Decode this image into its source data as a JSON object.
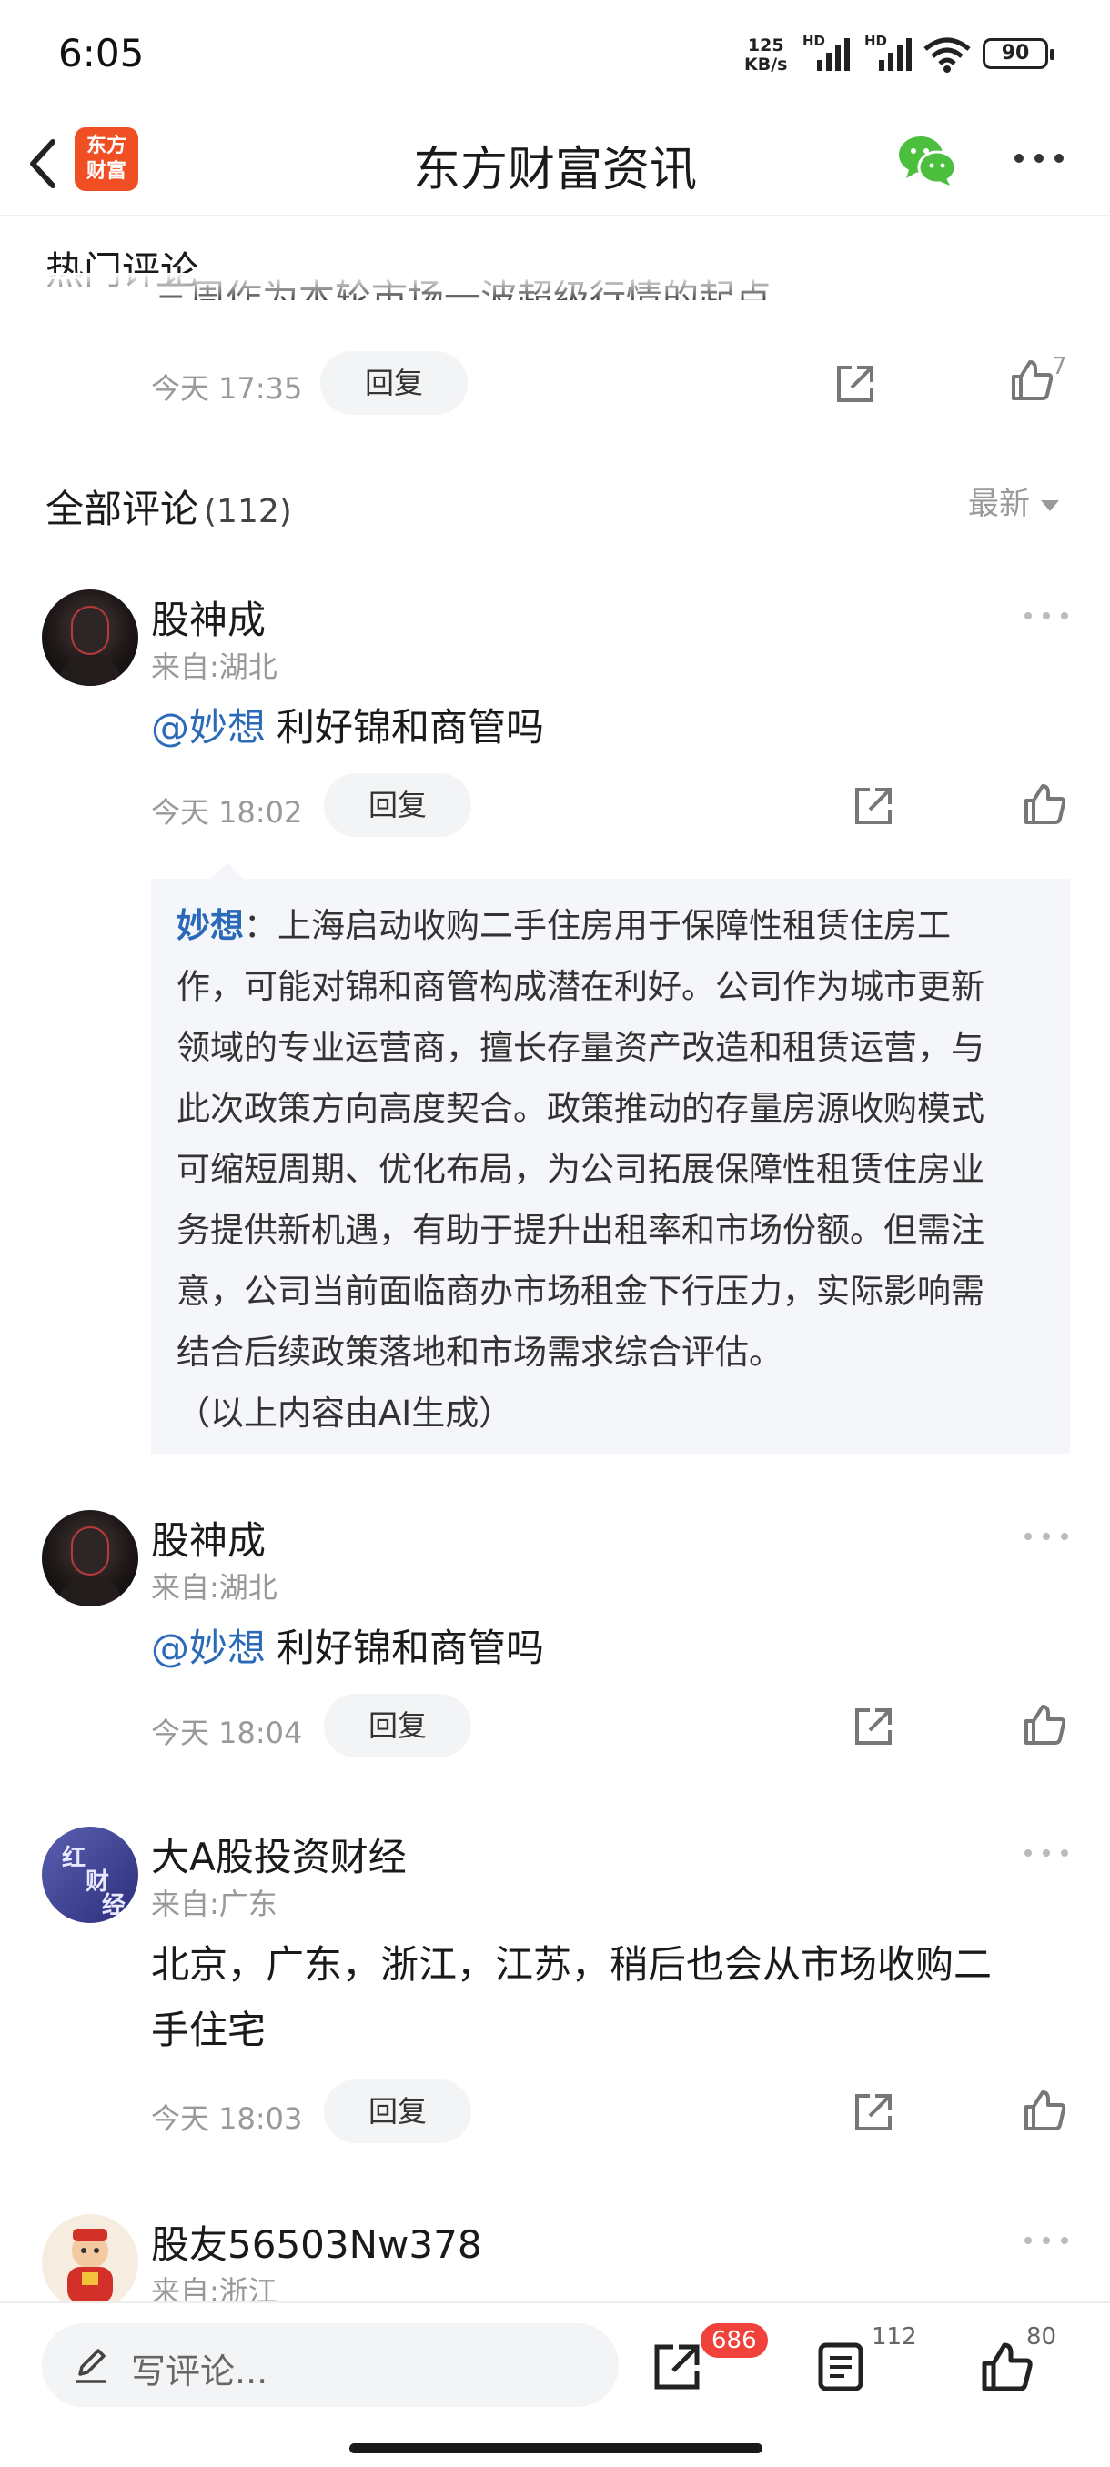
{
  "status_bar": {
    "time": "6:05",
    "net_speed_value": "125",
    "net_speed_unit": "KB/s",
    "signal_label_1": "HD",
    "signal_label_2": "HD",
    "battery": "90"
  },
  "nav": {
    "title": "东方财富资讯",
    "logo_line1": "东方",
    "logo_line2": "财富"
  },
  "hot_comments": {
    "title": "热门评论",
    "item": {
      "time": "今天 17:35",
      "reply_label": "回复",
      "like_count": "7"
    }
  },
  "all_comments": {
    "title": "全部评论",
    "count": "(112)",
    "sort_label": "最新"
  },
  "comments": [
    {
      "username": "股神成",
      "location": "来自:湖北",
      "mention": "@妙想",
      "text": "利好锦和商管吗",
      "time": "今天 18:02",
      "reply_label": "回复"
    },
    {
      "username": "股神成",
      "location": "来自:湖北",
      "mention": "@妙想",
      "text": "利好锦和商管吗",
      "time": "今天 18:04",
      "reply_label": "回复"
    },
    {
      "username": "大A股投资财经",
      "location": "来自:广东",
      "text_line1": "北京，广东，浙江，江苏，稍后也会从市场收购二",
      "text_line2": "手住宅",
      "time": "今天 18:03",
      "reply_label": "回复"
    },
    {
      "username": "股友56503Nw378",
      "location": "来自:浙江"
    }
  ],
  "ai_reply": {
    "author": "妙想",
    "lines": [
      "：上海启动收购二手住房用于保障性租赁住房工",
      "作，可能对锦和商管构成潜在利好。公司作为城市更新",
      "领域的专业运营商，擅长存量资产改造和租赁运营，与",
      "此次政策方向高度契合。政策推动的存量房源收购模式",
      "可缩短周期、优化布局，为公司拓展保障性租赁住房业",
      "务提供新机遇，有助于提升出租率和市场份额。但需注",
      "意，公司当前面临商办市场租金下行压力，实际影响需",
      "结合后续政策落地和市场需求综合评估。"
    ],
    "note": "（以上内容由AI生成）"
  },
  "bottom_bar": {
    "write_placeholder": "写评论...",
    "share_badge": "686",
    "comment_count": "112",
    "like_count": "80"
  },
  "colors": {
    "accent_blue": "#2a6ab8",
    "brand_orange": "#f04e23",
    "badge_red": "#f0413a",
    "wechat_green": "#4cbf3f"
  }
}
